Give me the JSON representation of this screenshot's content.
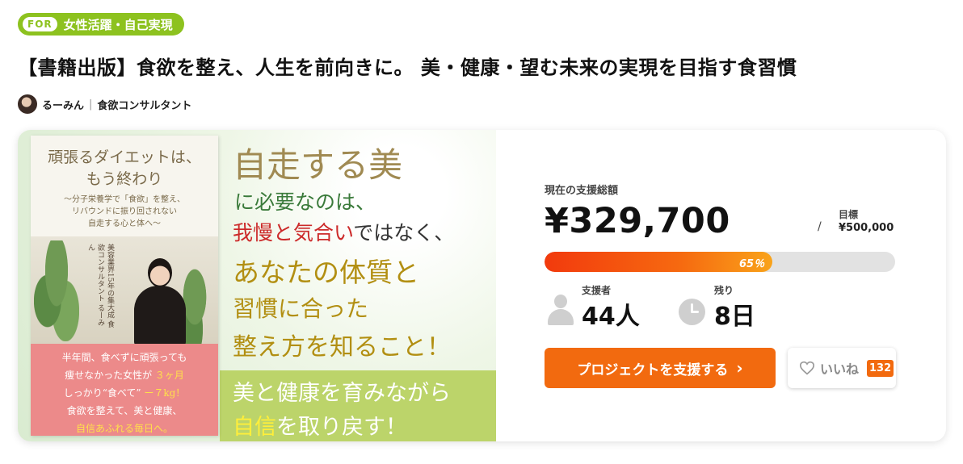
{
  "category": {
    "for_tag": "FOR",
    "label": "女性活躍・自己実現"
  },
  "project": {
    "title": "【書籍出版】食欲を整え、人生を前向きに。 美・健康・望む未来の実現を目指す食習慣"
  },
  "author": {
    "name": "るーみん",
    "role": "食欲コンサルタント"
  },
  "banner": {
    "book_title_1": "頑張るダイエットは、",
    "book_title_2": "もう終わり",
    "book_sub_1": "〜分子栄養学で「食欲」を整え、",
    "book_sub_2": "リバウンドに振り回されない",
    "book_sub_3": "自走する心と体へ〜",
    "book_vertical": "美容業界15年の集大成 食欲コンサルタント るーみん",
    "book_pink_1": "半年間、食べずに頑張っても",
    "book_pink_2": "痩せなかった女性が",
    "book_pink_2_hl": "３ヶ月",
    "book_pink_3": "しっかり“食べて”",
    "book_pink_3_hl": "ー７kg！",
    "book_pink_4": "食欲を整えて、美と健康、",
    "book_pink_5": "自信あふれる毎日へ。",
    "line1": "自走する美",
    "line2": "に必要なのは、",
    "line3_red": "我慢と気合い",
    "line3_rest": "ではなく、",
    "line4": "あなたの体質と",
    "line5": "習慣に合った",
    "line6": "整え方を知ること！",
    "line7": "美と健康を育みながら",
    "line8_hl": "自信",
    "line8_rest": "を取り戻す！"
  },
  "funding": {
    "amount_label": "現在の支援総額",
    "amount": "¥329,700",
    "slash": "/",
    "goal_label": "目標",
    "goal": "¥500,000",
    "percent": 65,
    "percent_text": "65％",
    "supporters_label": "支援者",
    "supporters": "44人",
    "remaining_label": "残り",
    "remaining": "8日"
  },
  "actions": {
    "support_label": "プロジェクトを支援する",
    "like_label": "いいね",
    "like_count": "132"
  },
  "colors": {
    "accent": "#f26a0f",
    "category": "#8dc21f"
  }
}
